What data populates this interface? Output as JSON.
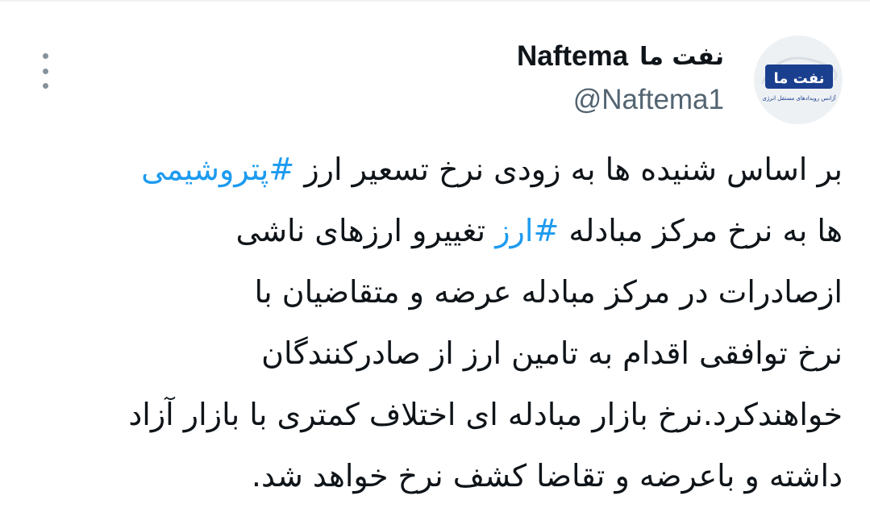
{
  "author": {
    "display_name_fa": "نفت ما",
    "display_name_en": "Naftema",
    "handle": "@Naftema1",
    "avatar_text": "نفت ما",
    "avatar_subtext": "آژانس رویدادهای مستقل انرژی"
  },
  "tweet": {
    "line1_text": "بر اساس شنیده ها به زودی نرخ تسعیر ارز ",
    "hashtag1": "#پتروشیمی",
    "line2_text_before": "ها به نرخ مرکز مبادله ",
    "hashtag2": "#ارز",
    "line2_text_after": " تغییرو ارزهای ناشی",
    "line3": "ازصادرات در مرکز مبادله عرضه و متقاضیان با",
    "line4": "نرخ توافقی اقدام به تامین ارز از صادرکنندگان",
    "line5": "خواهندکرد.نرخ بازار مبادله ای اختلاف کمتری با بازار آزاد",
    "line6": "داشته و باعرضه و تقاضا کشف نرخ خواهد شد."
  },
  "colors": {
    "text": "#0f1419",
    "secondary": "#536471",
    "hashtag": "#1d9bf0",
    "avatar_logo": "#1b3f8f"
  },
  "icons": {
    "more": "more-vertical-icon"
  }
}
